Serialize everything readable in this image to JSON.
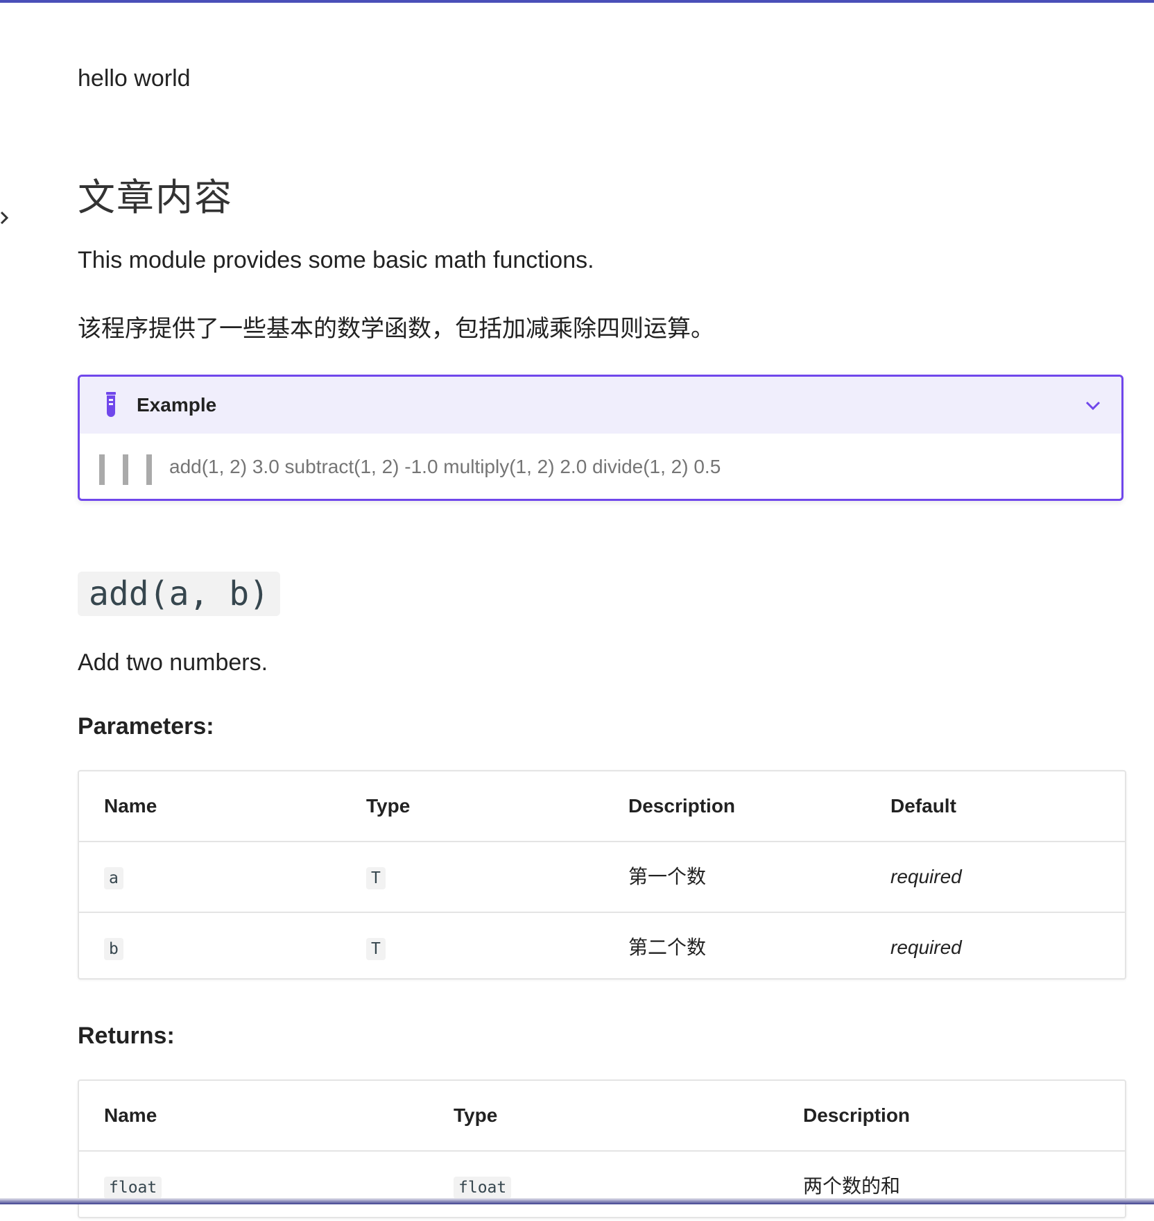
{
  "intro": {
    "text": "hello world"
  },
  "section": {
    "title": "文章内容",
    "desc_en": "This module provides some basic math functions.",
    "desc_cn": "该程序提供了一些基本的数学函数，包括加减乘除四则运算。"
  },
  "example": {
    "title": "Example",
    "icon": "test-tube-icon",
    "expand_icon": "chevron-down-icon",
    "body": "add(1, 2) 3.0 subtract(1, 2) -1.0 multiply(1, 2) 2.0 divide(1, 2) 0.5",
    "accent_color": "#7047eb"
  },
  "function": {
    "signature": "add(a, b)",
    "summary": "Add two numbers."
  },
  "parameters": {
    "heading": "Parameters:",
    "columns": [
      "Name",
      "Type",
      "Description",
      "Default"
    ],
    "rows": [
      [
        "a",
        "T",
        "第一个数",
        "required"
      ],
      [
        "b",
        "T",
        "第二个数",
        "required"
      ]
    ]
  },
  "returns": {
    "heading": "Returns:",
    "columns": [
      "Name",
      "Type",
      "Description"
    ],
    "rows": [
      [
        "float",
        "float",
        "两个数的和"
      ]
    ]
  },
  "theme": {
    "primary": "#4a4fb8",
    "accent": "#7047eb"
  }
}
